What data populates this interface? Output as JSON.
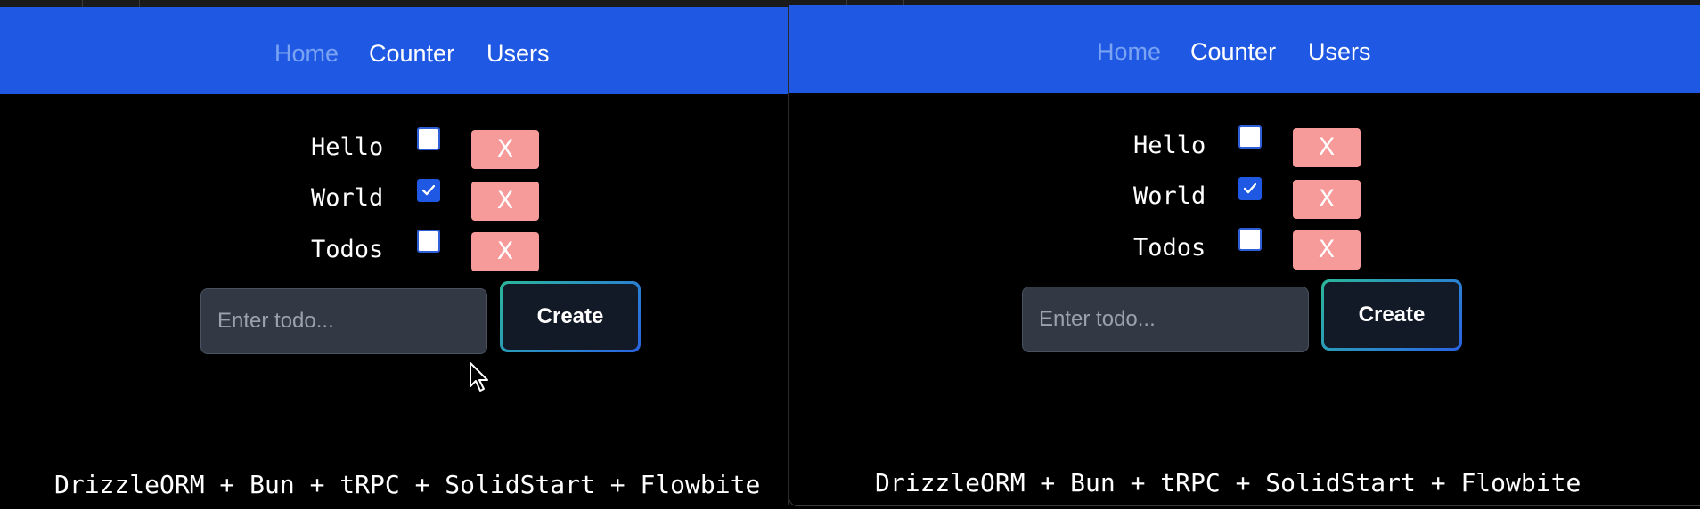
{
  "colors": {
    "navbar": "#1f58e2",
    "nav_active": "#7aa3f3",
    "delete_button": "#f69a9a",
    "checkbox_checked": "#1f58e2",
    "input_background": "#323944",
    "create_background": "#131a27"
  },
  "windows": [
    {
      "nav": {
        "home": "Home",
        "counter": "Counter",
        "users": "Users"
      },
      "todos": [
        {
          "label": "Hello",
          "checked": false,
          "delete_label": "X"
        },
        {
          "label": "World",
          "checked": true,
          "delete_label": "X"
        },
        {
          "label": "Todos",
          "checked": false,
          "delete_label": "X"
        }
      ],
      "input": {
        "placeholder": "Enter todo...",
        "value": ""
      },
      "create_label": "Create",
      "footer": "DrizzleORM + Bun + tRPC + SolidStart + Flowbite"
    },
    {
      "nav": {
        "home": "Home",
        "counter": "Counter",
        "users": "Users"
      },
      "todos": [
        {
          "label": "Hello",
          "checked": false,
          "delete_label": "X"
        },
        {
          "label": "World",
          "checked": true,
          "delete_label": "X"
        },
        {
          "label": "Todos",
          "checked": false,
          "delete_label": "X"
        }
      ],
      "input": {
        "placeholder": "Enter todo...",
        "value": ""
      },
      "create_label": "Create",
      "footer": "DrizzleORM + Bun + tRPC + SolidStart + Flowbite"
    }
  ],
  "icons": {
    "check": "check-icon",
    "pointer": "mouse-pointer-icon"
  }
}
